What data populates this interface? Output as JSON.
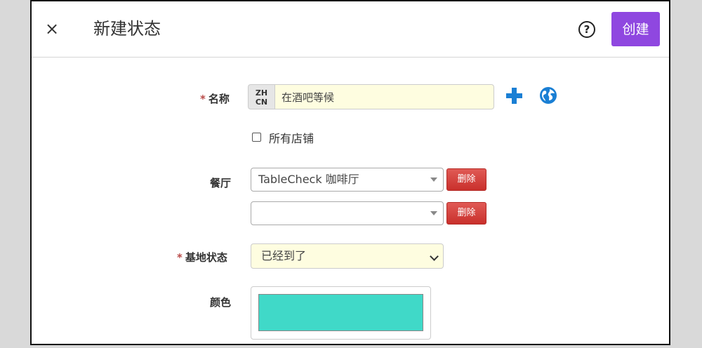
{
  "header": {
    "close_glyph": "×",
    "title": "新建状态",
    "help_glyph": "?",
    "create_label": "创建"
  },
  "form": {
    "name": {
      "required_mark": "*",
      "label": "名称",
      "lang_line1": "ZH",
      "lang_line2": "CN",
      "value": "在酒吧等候",
      "add_icon": "plus-icon",
      "translate_icon": "globe-icon"
    },
    "all_shops": {
      "label": "所有店铺",
      "checked": false
    },
    "restaurant": {
      "label": "餐厅",
      "rows": [
        {
          "value": "TableCheck 咖啡厅",
          "delete_label": "删除"
        },
        {
          "value": "",
          "delete_label": "删除"
        }
      ]
    },
    "base_status": {
      "required_mark": "*",
      "label": "基地状态",
      "value": "已经到了"
    },
    "color": {
      "label": "颜色",
      "value": "#40d9c8"
    }
  },
  "colors": {
    "accent": "#8f47e0",
    "danger": "#c9302c",
    "icon_blue": "#1a7fd4",
    "required_input_bg": "#fefde0"
  }
}
